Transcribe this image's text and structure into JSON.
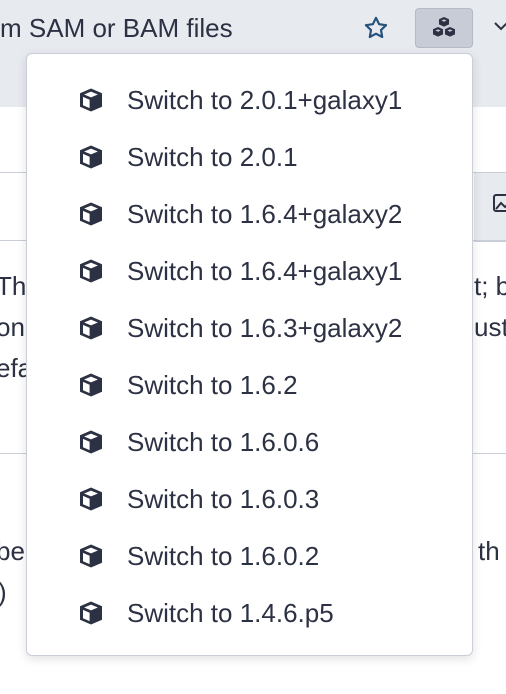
{
  "tool": {
    "title": "m SAM or BAM files",
    "star_icon": "star-outline-icon",
    "versions_icon": "cubes-icon",
    "caret_icon": "chevron-down-icon"
  },
  "background_fragments": {
    "row1_left": "The",
    "row1_right": "t; b",
    "row2_left": "on",
    "row2_right": "ust",
    "row3_left": "efa",
    "row4_left": "be",
    "row4_right": "th",
    "row5_left": ")"
  },
  "versions_menu": {
    "item_icon": "cube-icon",
    "items": [
      {
        "label": "Switch to 2.0.1+galaxy1"
      },
      {
        "label": "Switch to 2.0.1"
      },
      {
        "label": "Switch to 1.6.4+galaxy2"
      },
      {
        "label": "Switch to 1.6.4+galaxy1"
      },
      {
        "label": "Switch to 1.6.3+galaxy2"
      },
      {
        "label": "Switch to 1.6.2"
      },
      {
        "label": "Switch to 1.6.0.6"
      },
      {
        "label": "Switch to 1.6.0.3"
      },
      {
        "label": "Switch to 1.6.0.2"
      },
      {
        "label": "Switch to 1.4.6.p5"
      }
    ]
  },
  "colors": {
    "header_bg": "#e7eaef",
    "text": "#2c3143",
    "star_blue": "#25537b",
    "active_button_bg": "#c7ccd6",
    "border": "#c9ced7"
  }
}
